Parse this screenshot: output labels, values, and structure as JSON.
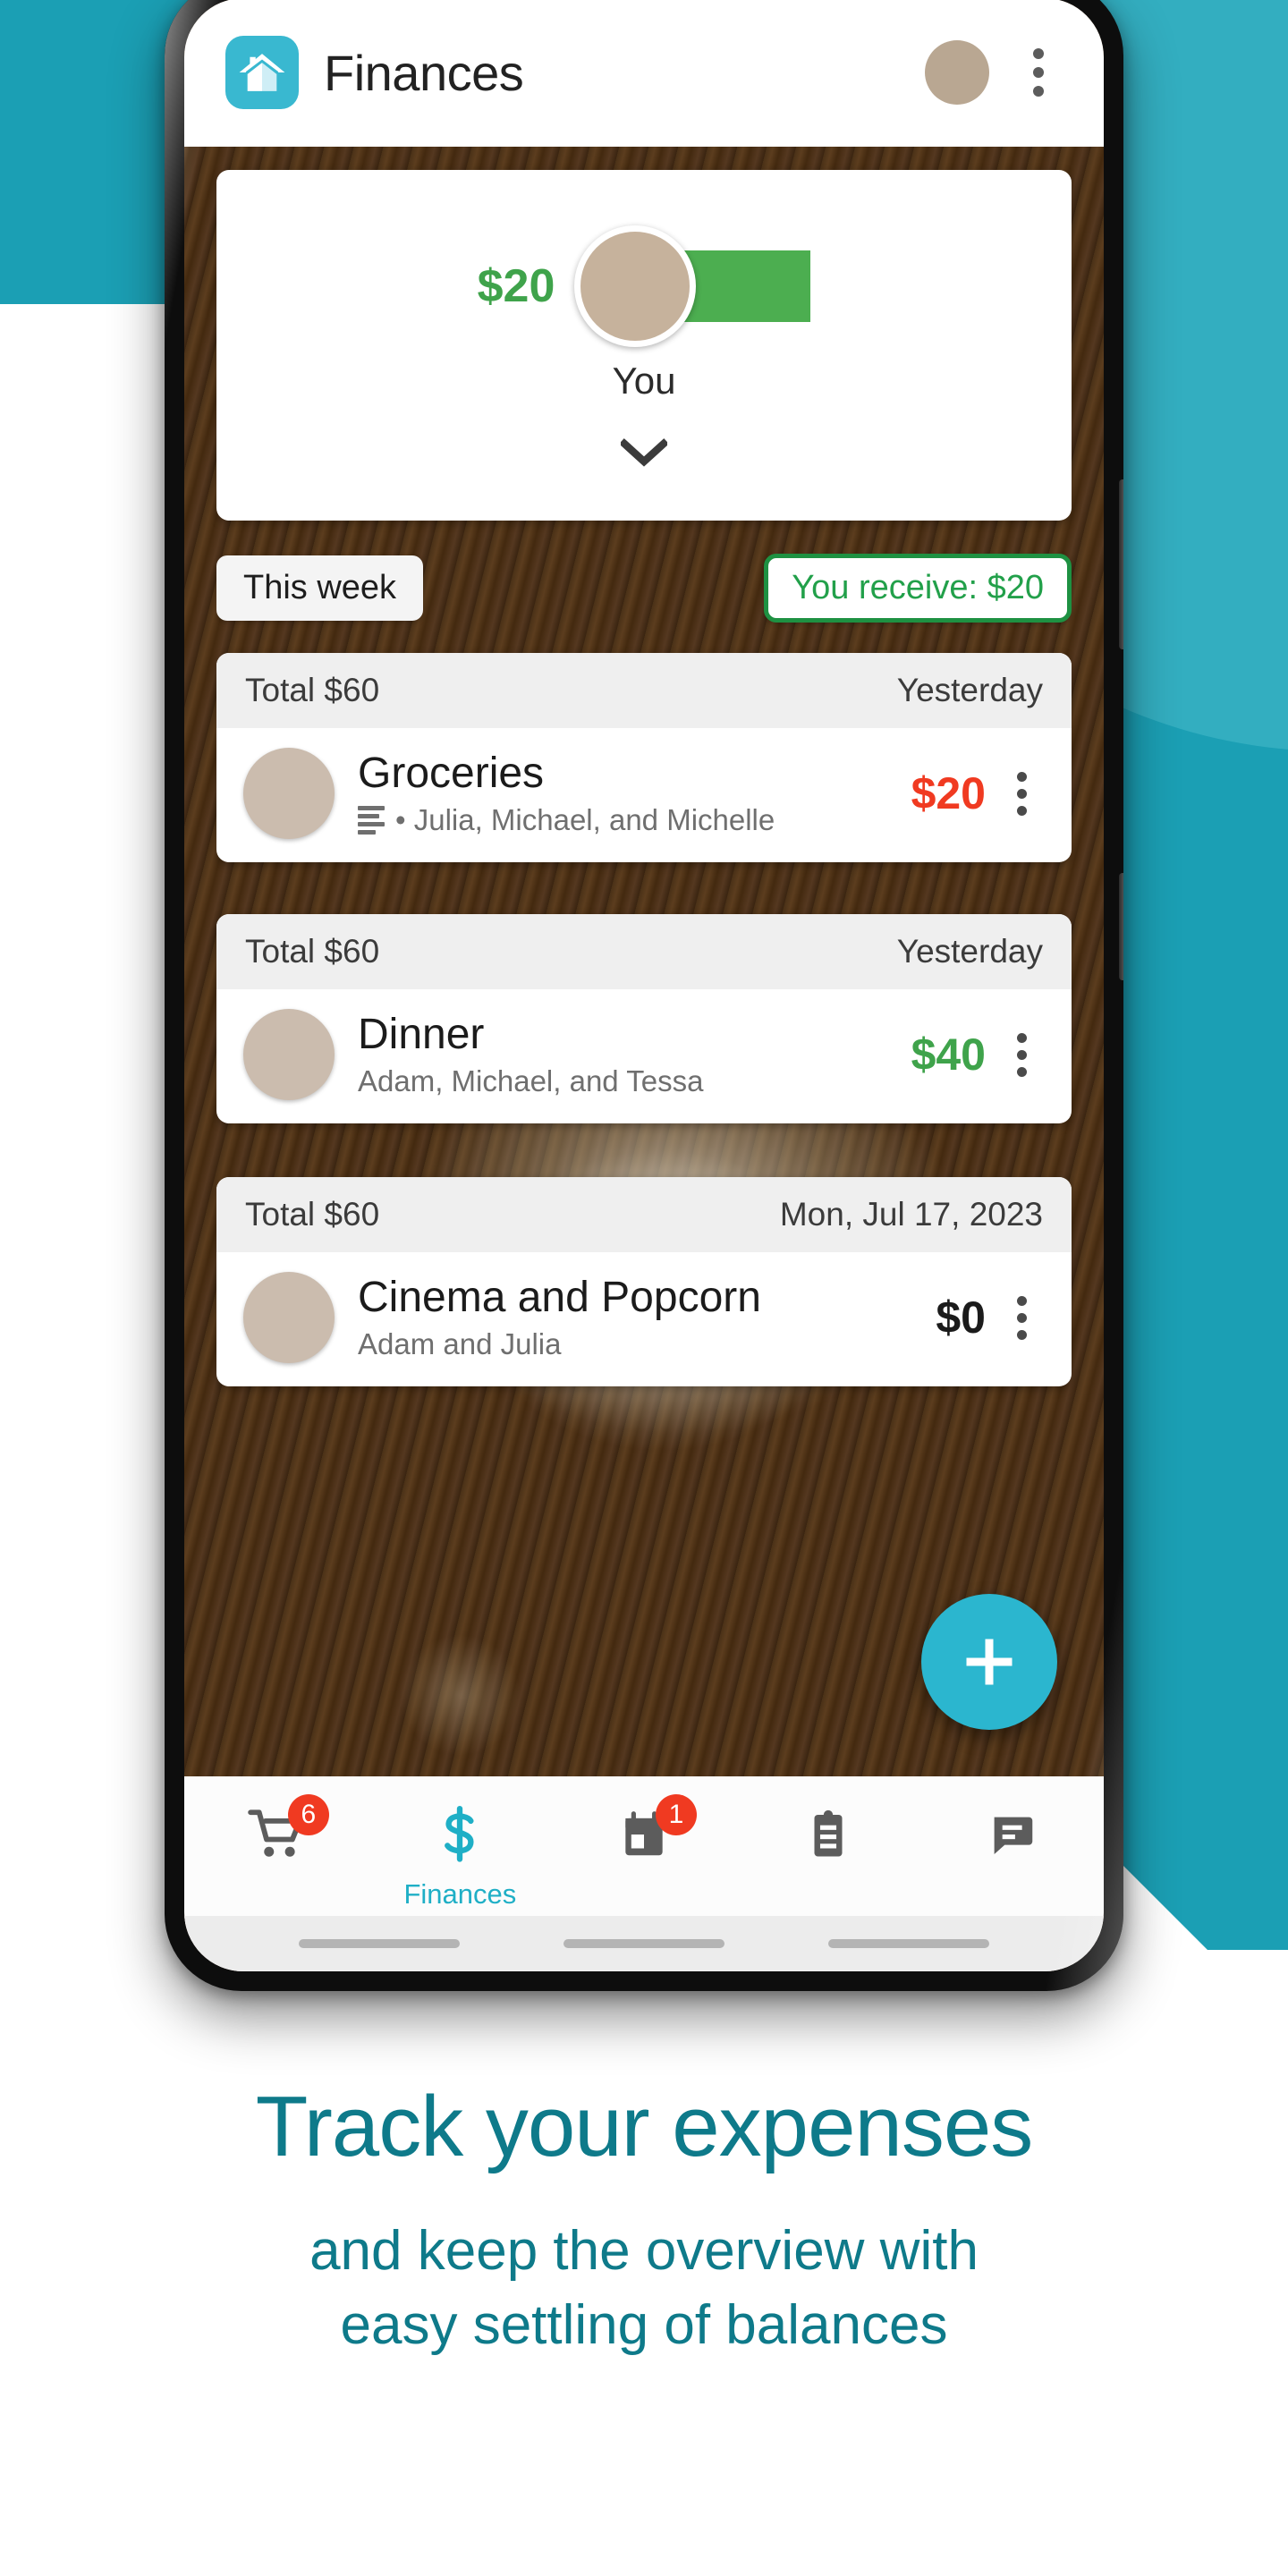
{
  "colors": {
    "brand_teal": "#1B9FB4",
    "brand_teal_light": "#56C4D3",
    "accent_cyan": "#2BB6CF",
    "headline_teal": "#0E7A8A",
    "positive_green": "#3FA34B",
    "bar_green": "#4CAE50",
    "negative_red": "#F03A21",
    "badge_red": "#F03A21"
  },
  "appbar": {
    "logo_icon": "house-icon",
    "title": "Finances",
    "avatar_icon": "user-avatar",
    "overflow_icon": "kebab-menu-icon"
  },
  "balance_card": {
    "amount": "$20",
    "name": "You",
    "expand_icon": "chevron-down-icon"
  },
  "filters": {
    "period_chip": "This week",
    "summary_chip": "You receive: $20"
  },
  "expenses": [
    {
      "total": "Total $60",
      "date": "Yesterday",
      "title": "Groceries",
      "participants": "• Julia, Michael, and Michelle",
      "has_note_icon": true,
      "amount": "$20",
      "amount_style": "red",
      "avatar_icon": "woman-avatar",
      "overflow_icon": "kebab-menu-icon"
    },
    {
      "total": "Total $60",
      "date": "Yesterday",
      "title": "Dinner",
      "participants": "Adam, Michael, and Tessa",
      "has_note_icon": false,
      "amount": "$40",
      "amount_style": "green",
      "avatar_icon": "man-avatar",
      "overflow_icon": "kebab-menu-icon"
    },
    {
      "total": "Total $60",
      "date": "Mon, Jul 17, 2023",
      "title": "Cinema and Popcorn",
      "participants": "Adam and Julia",
      "has_note_icon": false,
      "amount": "$0",
      "amount_style": "dark",
      "avatar_icon": "man-avatar-2",
      "overflow_icon": "kebab-menu-icon"
    }
  ],
  "fab": {
    "icon": "plus-icon",
    "label": "Add expense"
  },
  "bottom_nav": [
    {
      "icon": "shopping-cart-icon",
      "label": "",
      "badge": "6",
      "active": false
    },
    {
      "icon": "dollar-sign-icon",
      "label": "Finances",
      "badge": "",
      "active": true
    },
    {
      "icon": "calendar-icon",
      "label": "",
      "badge": "1",
      "active": false
    },
    {
      "icon": "clipboard-icon",
      "label": "",
      "badge": "",
      "active": false
    },
    {
      "icon": "chat-bubble-icon",
      "label": "",
      "badge": "",
      "active": false
    }
  ],
  "marketing": {
    "headline": "Track your expenses",
    "subline_1": "and keep the overview with",
    "subline_2": "easy settling of balances"
  }
}
